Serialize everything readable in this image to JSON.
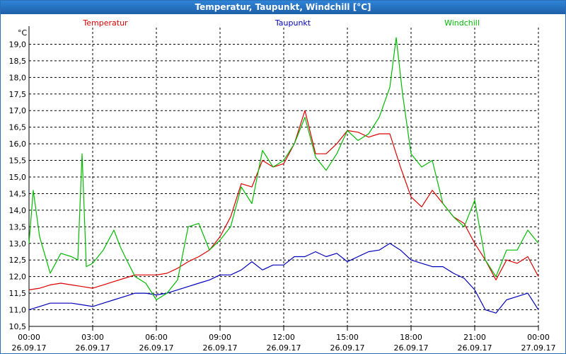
{
  "window": {
    "title": "Temperatur, Taupunkt, Windchill [°C]"
  },
  "chart_data": {
    "type": "line",
    "title": "Temperatur, Taupunkt, Windchill [°C]",
    "ylabel": "°C",
    "xlabel": "",
    "ylim": [
      10.5,
      19.5
    ],
    "xlim": [
      0,
      24
    ],
    "grid": true,
    "legend_position": "top",
    "y_ticks": [
      "10,5",
      "11,0",
      "11,5",
      "12,0",
      "12,5",
      "13,0",
      "13,5",
      "14,0",
      "14,5",
      "15,0",
      "15,5",
      "16,0",
      "16,5",
      "17,0",
      "17,5",
      "18,0",
      "18,5",
      "19,0"
    ],
    "x_ticks": [
      {
        "time": "00:00",
        "date": "26.09.17"
      },
      {
        "time": "03:00",
        "date": "26.09.17"
      },
      {
        "time": "06:00",
        "date": "26.09.17"
      },
      {
        "time": "09:00",
        "date": "26.09.17"
      },
      {
        "time": "12:00",
        "date": "26.09.17"
      },
      {
        "time": "15:00",
        "date": "26.09.17"
      },
      {
        "time": "18:00",
        "date": "26.09.17"
      },
      {
        "time": "21:00",
        "date": "26.09.17"
      },
      {
        "time": "00:00",
        "date": "27.09.17"
      }
    ],
    "series": [
      {
        "name": "Temperatur",
        "color": "#dd0000",
        "x": [
          0,
          0.5,
          1,
          1.5,
          2,
          2.5,
          3,
          3.5,
          4,
          4.5,
          5,
          5.5,
          6,
          6.5,
          7,
          7.5,
          8,
          8.5,
          9,
          9.5,
          10,
          10.5,
          11,
          11.5,
          12,
          12.5,
          13,
          13.5,
          14,
          14.5,
          15,
          15.5,
          16,
          16.5,
          17,
          17.5,
          18,
          18.5,
          19,
          19.5,
          20,
          20.5,
          21,
          21.5,
          22,
          22.5,
          23,
          23.5,
          24
        ],
        "values": [
          11.6,
          11.65,
          11.75,
          11.8,
          11.75,
          11.7,
          11.65,
          11.75,
          11.85,
          11.95,
          12.05,
          12.05,
          12.05,
          12.1,
          12.25,
          12.45,
          12.6,
          12.8,
          13.2,
          13.8,
          14.8,
          14.7,
          15.5,
          15.3,
          15.4,
          16.0,
          17.0,
          15.7,
          15.7,
          16.0,
          16.4,
          16.35,
          16.2,
          16.3,
          16.3,
          15.3,
          14.4,
          14.1,
          14.6,
          14.2,
          13.8,
          13.6,
          13.0,
          12.5,
          11.9,
          12.5,
          12.4,
          12.6,
          12.0
        ]
      },
      {
        "name": "Taupunkt",
        "color": "#0000bb",
        "x": [
          0,
          0.5,
          1,
          1.5,
          2,
          2.5,
          3,
          3.5,
          4,
          4.5,
          5,
          5.5,
          6,
          6.5,
          7,
          7.5,
          8,
          8.5,
          9,
          9.5,
          10,
          10.5,
          11,
          11.5,
          12,
          12.5,
          13,
          13.5,
          14,
          14.5,
          15,
          15.5,
          16,
          16.5,
          17,
          17.5,
          18,
          18.5,
          19,
          19.5,
          20,
          20.5,
          21,
          21.5,
          22,
          22.5,
          23,
          23.5,
          24
        ],
        "values": [
          11.0,
          11.1,
          11.2,
          11.2,
          11.2,
          11.15,
          11.1,
          11.2,
          11.3,
          11.4,
          11.5,
          11.5,
          11.45,
          11.5,
          11.6,
          11.7,
          11.8,
          11.9,
          12.05,
          12.05,
          12.2,
          12.45,
          12.2,
          12.35,
          12.35,
          12.6,
          12.6,
          12.75,
          12.6,
          12.7,
          12.45,
          12.6,
          12.75,
          12.8,
          13.0,
          12.8,
          12.5,
          12.4,
          12.3,
          12.3,
          12.1,
          11.95,
          11.6,
          11.0,
          10.9,
          11.3,
          11.4,
          11.5,
          11.0
        ]
      },
      {
        "name": "Windchill",
        "color": "#00bb00",
        "x": [
          0,
          0.2,
          0.5,
          1,
          1.5,
          2,
          2.3,
          2.5,
          2.7,
          3,
          3.5,
          4,
          4.3,
          4.6,
          5,
          5.5,
          6,
          6.5,
          7,
          7.5,
          8,
          8.5,
          9,
          9.5,
          10,
          10.5,
          11,
          11.5,
          12,
          12.5,
          13,
          13.5,
          14,
          14.5,
          15,
          15.5,
          16,
          16.5,
          17,
          17.3,
          17.6,
          18,
          18.5,
          19,
          19.5,
          20,
          20.5,
          21,
          21.5,
          22,
          22.5,
          23,
          23.5,
          24
        ],
        "values": [
          13.0,
          14.6,
          13.2,
          12.1,
          12.7,
          12.6,
          12.5,
          15.7,
          12.3,
          12.4,
          12.8,
          13.4,
          12.9,
          12.5,
          12.0,
          11.8,
          11.3,
          11.5,
          11.9,
          13.5,
          13.6,
          12.8,
          13.1,
          13.5,
          14.7,
          14.2,
          15.8,
          15.3,
          15.5,
          16.0,
          16.8,
          15.6,
          15.2,
          15.7,
          16.4,
          16.1,
          16.3,
          16.8,
          17.7,
          19.2,
          17.5,
          15.7,
          15.3,
          15.5,
          14.2,
          13.8,
          13.5,
          14.3,
          12.5,
          12.0,
          12.8,
          12.8,
          13.4,
          13.0
        ]
      }
    ]
  }
}
